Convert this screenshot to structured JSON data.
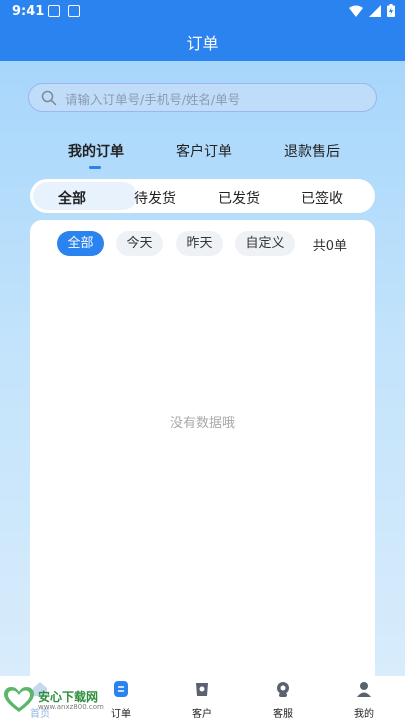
{
  "status_bar": {
    "time": "9:41"
  },
  "header": {
    "title": "订单"
  },
  "search": {
    "placeholder": "请输入订单号/手机号/姓名/单号"
  },
  "main_tabs": [
    {
      "label": "我的订单",
      "active": true
    },
    {
      "label": "客户订单",
      "active": false
    },
    {
      "label": "退款售后",
      "active": false
    }
  ],
  "status_filter": [
    {
      "label": "全部",
      "active": true
    },
    {
      "label": "待发货",
      "active": false
    },
    {
      "label": "已发货",
      "active": false
    },
    {
      "label": "已签收",
      "active": false
    }
  ],
  "date_filter": [
    {
      "label": "全部",
      "active": true
    },
    {
      "label": "今天",
      "active": false
    },
    {
      "label": "昨天",
      "active": false
    },
    {
      "label": "自定义",
      "active": false
    }
  ],
  "order_count": "共0单",
  "empty_message": "没有数据哦",
  "bottom_nav": [
    {
      "label": "首页",
      "icon": "home-icon"
    },
    {
      "label": "订单",
      "icon": "order-icon",
      "active": true
    },
    {
      "label": "客户",
      "icon": "customer-icon"
    },
    {
      "label": "客服",
      "icon": "service-icon"
    },
    {
      "label": "我的",
      "icon": "profile-icon"
    }
  ],
  "watermark": {
    "title": "安心下载网",
    "url": "www.anxz800.com",
    "badge_text": "安心 下载"
  },
  "colors": {
    "primary": "#2a83ee",
    "gradient_top": "#a7d6fb",
    "gradient_bottom": "#d8ecfb",
    "empty_text": "#a9a9a9"
  }
}
